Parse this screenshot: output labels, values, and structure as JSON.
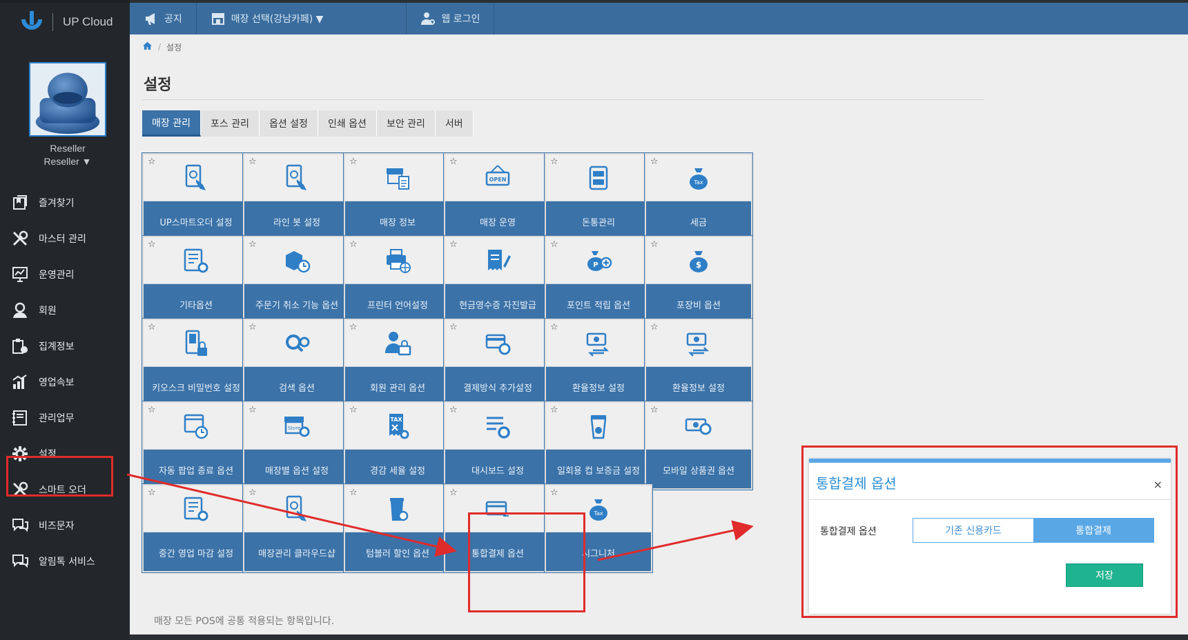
{
  "app": {
    "name": "UP Cloud"
  },
  "user": {
    "role": "Reseller",
    "name": "Reseller ▼"
  },
  "sidebar": {
    "items": [
      {
        "label": "즐겨찾기",
        "icon": "bookmark-icon"
      },
      {
        "label": "마스터 관리",
        "icon": "tools-icon"
      },
      {
        "label": "운영관리",
        "icon": "chart-monitor-icon"
      },
      {
        "label": "회원",
        "icon": "member-icon"
      },
      {
        "label": "집계정보",
        "icon": "clipboard-chart-icon"
      },
      {
        "label": "영업속보",
        "icon": "bar-chart-icon"
      },
      {
        "label": "관리업무",
        "icon": "notebook-icon"
      },
      {
        "label": "설정",
        "icon": "gear-icon"
      },
      {
        "label": "스마트 오더",
        "icon": "tools-icon"
      },
      {
        "label": "비즈문자",
        "icon": "chat-icon"
      },
      {
        "label": "알림톡 서비스",
        "icon": "chat-icon"
      }
    ]
  },
  "topbar": {
    "notice": "공지",
    "store_select": "매장 선택(강남카페) ▼",
    "web_login": "웹 로그인"
  },
  "breadcrumb": {
    "current": "설정"
  },
  "page": {
    "title": "설정"
  },
  "tabs": [
    "매장 관리",
    "포스 관리",
    "옵션 설정",
    "인쇄 옵션",
    "보안 관리",
    "서버"
  ],
  "tiles": [
    {
      "label": "UP스마트오더 설정",
      "icon": "tablet-touch-icon"
    },
    {
      "label": "라인 봇 설정",
      "icon": "tablet-touch-icon"
    },
    {
      "label": "매장 정보",
      "icon": "store-doc-icon"
    },
    {
      "label": "매장 운영",
      "icon": "open-sign-icon"
    },
    {
      "label": "돈통관리",
      "icon": "cash-drawer-icon"
    },
    {
      "label": "세금",
      "icon": "tax-bag-icon"
    },
    {
      "label": "기타옵션",
      "icon": "doc-gear-icon"
    },
    {
      "label": "주문기 취소 기능 옵션",
      "icon": "box-clock-icon"
    },
    {
      "label": "프린터 언어설정",
      "icon": "printer-globe-icon"
    },
    {
      "label": "현금영수증 자진발급",
      "icon": "receipt-pen-icon"
    },
    {
      "label": "포인트 적립 옵션",
      "icon": "point-bag-icon"
    },
    {
      "label": "포장비 옵션",
      "icon": "money-bag-icon"
    },
    {
      "label": "키오스크 비밀번호 설정",
      "icon": "kiosk-lock-icon"
    },
    {
      "label": "검색 옵션",
      "icon": "search-gear-icon"
    },
    {
      "label": "회원 관리 옵션",
      "icon": "user-lock-icon"
    },
    {
      "label": "결제방식 추가설정",
      "icon": "card-gear-icon"
    },
    {
      "label": "환율정보 설정",
      "icon": "currency-exchange-icon"
    },
    {
      "label": "환율정보 설정",
      "icon": "currency-exchange-icon"
    },
    {
      "label": "자동 팝업 종료 옵션",
      "icon": "window-clock-icon"
    },
    {
      "label": "매장별 옵션 설정",
      "icon": "store-gear-icon"
    },
    {
      "label": "경감 세율 설정",
      "icon": "tax-receipt-icon"
    },
    {
      "label": "대시보드 설정",
      "icon": "list-gear-icon"
    },
    {
      "label": "일회용 컵 보증금 설정",
      "icon": "cup-icon"
    },
    {
      "label": "모바일 상품권 옵션",
      "icon": "voucher-gear-icon"
    },
    {
      "label": "중간 영업 마감 설정",
      "icon": "doc-gear-icon"
    },
    {
      "label": "매장관리 클라우드샵",
      "icon": "tablet-touch-icon"
    },
    {
      "label": "텀블러 할인 옵션",
      "icon": "tumbler-icon"
    },
    {
      "label": "통합결제 옵션",
      "icon": "credit-card-icon"
    },
    {
      "label": "시그니처",
      "icon": "tax-bag-icon"
    }
  ],
  "footer_note": "매장 모든 POS에 공통 적용되는 항목입니다.",
  "dialog": {
    "title": "통합결제 옵션",
    "close": "×",
    "option_label": "통합결제 옵션",
    "choice_existing": "기존 신용카드",
    "choice_integrated": "통합결제",
    "save": "저장"
  },
  "colors": {
    "sidebar_bg": "#23272b",
    "topbar_bg": "#3a6d9e",
    "tile_blue": "#3b72a8",
    "dialog_accent": "#5aa7e6",
    "save_green": "#1fb38f",
    "annotation_red": "#e02b2b"
  }
}
